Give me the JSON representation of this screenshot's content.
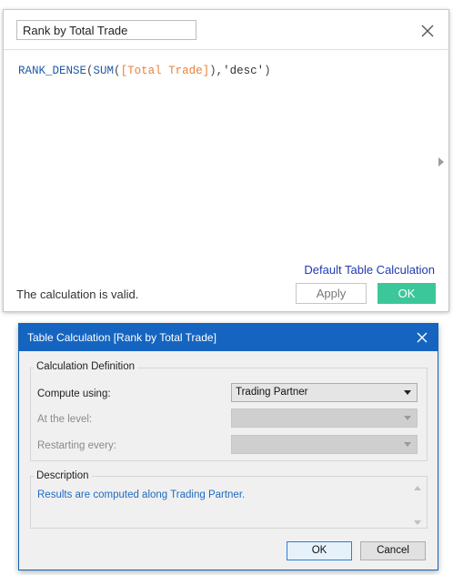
{
  "calc_editor": {
    "name_value": "Rank by Total Trade",
    "formula": {
      "fn1": "RANK_DENSE",
      "p1": "(",
      "fn2": "SUM",
      "p2": "(",
      "field": "[Total Trade]",
      "p3": "),",
      "str": "'desc'",
      "p4": ")"
    },
    "default_table_calc_link": "Default Table Calculation",
    "status": "The calculation is valid.",
    "apply_label": "Apply",
    "ok_label": "OK",
    "colors": {
      "ok": "#3bc79a",
      "link": "#1f3ab0",
      "fn": "#1f5aa8",
      "field": "#e8823a"
    }
  },
  "table_calc_dialog": {
    "title": "Table Calculation [Rank by Total Trade]",
    "definition_group": "Calculation Definition",
    "compute_using_label": "Compute using:",
    "compute_using_value": "Trading Partner",
    "level_label": "At the level:",
    "level_value": "",
    "restarting_label": "Restarting every:",
    "restarting_value": "",
    "description_group": "Description",
    "description_text": "Results are computed along Trading Partner.",
    "ok_label": "OK",
    "cancel_label": "Cancel",
    "colors": {
      "title_bar": "#1565c0",
      "description": "#1f6bc4"
    }
  }
}
